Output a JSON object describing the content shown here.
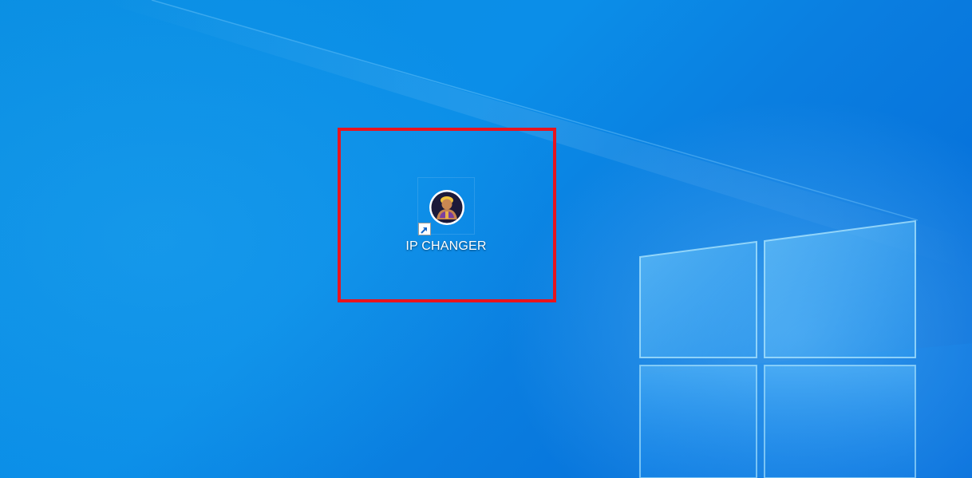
{
  "desktop": {
    "wallpaper": "windows-10-hero",
    "accent_color": "#0a8fe3"
  },
  "icons": [
    {
      "label": "IP CHANGER",
      "icon": "ip-changer-app-icon",
      "shortcut": true
    }
  ],
  "highlight": {
    "color": "#e8141e"
  }
}
